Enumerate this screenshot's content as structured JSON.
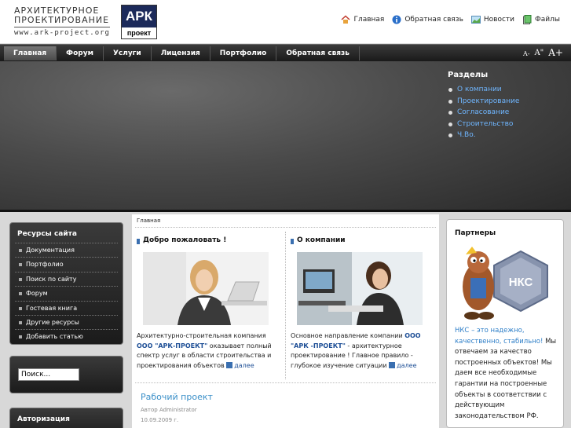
{
  "header": {
    "logo_line1": "АРХИТЕКТУРНОЕ",
    "logo_line2": "ПРОЕКТИРОВАНИЕ",
    "logo_url": "www.ark-project.org",
    "badge_top": "АРК",
    "badge_bottom": "проект",
    "toplinks": [
      "Главная",
      "Обратная связь",
      "Новости",
      "Файлы"
    ]
  },
  "menu": {
    "items": [
      "Главная",
      "Форум",
      "Услуги",
      "Лицензия",
      "Портфолио",
      "Обратная связь"
    ],
    "font_small": "A-",
    "font_medium": "A\"",
    "font_large": "A+"
  },
  "sections": {
    "title": "Разделы",
    "items": [
      "О компании",
      "Проектирование",
      "Согласование",
      "Строительство",
      "Ч.Во."
    ]
  },
  "left": {
    "resources_title": "Ресурсы сайта",
    "resources": [
      "Документация",
      "Портфолио",
      "Поиск по сайту",
      "Форум",
      "Гостевая книга",
      "Другие ресурсы",
      "Добавить статью"
    ],
    "search_placeholder": "Поиск...",
    "auth_title": "Авторизация"
  },
  "main": {
    "breadcrumb": "Главная",
    "col1": {
      "title": "Добро пожаловать !",
      "text_a": "Архитектурно-строительная компания ",
      "company": "ООО \"АРК-ПРОЕКТ\"",
      "text_b": " оказывает полный спектр услуг в области строительства и проектирования объектов",
      "more": "далее"
    },
    "col2": {
      "title": "О компании",
      "text_a": "Основное направление компании ",
      "company": "ООО \"АРК -ПРОЕКТ\"",
      "text_b": " - архитектурное проектирование ! Главное правило - глубокое изучение ситуации",
      "more": "далее"
    },
    "article": {
      "title": "Рабочий проект",
      "author": "Автор Administrator",
      "date": "10.09.2009 г."
    }
  },
  "partners": {
    "title": "Партнеры",
    "logo_text": "НКС",
    "highlight": "НКС – это надежно, качественно, стабильно!",
    "text": " Мы отвечаем за качество построенных объектов! Мы даем все необходимые гарантии на построенные объекты в соответствии с действующим законодательством РФ."
  },
  "colors": {
    "accent": "#3a8fc8",
    "link_blue": "#1e4f96",
    "section_link": "#6fb6ff",
    "dark_panel": "#222222"
  }
}
